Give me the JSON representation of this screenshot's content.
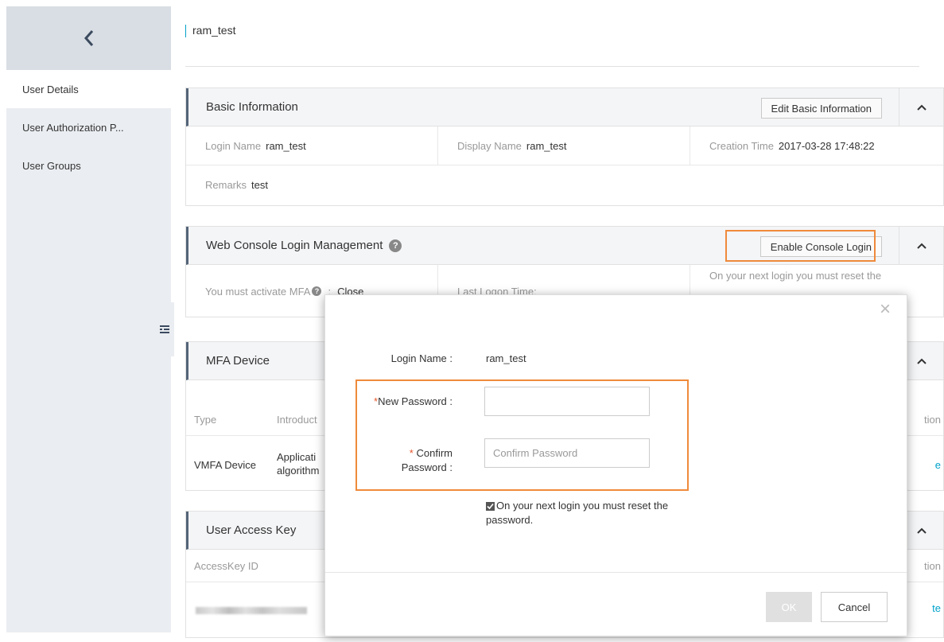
{
  "sidebar": {
    "items": [
      {
        "label": "User Details"
      },
      {
        "label": "User Authorization P..."
      },
      {
        "label": "User Groups"
      }
    ]
  },
  "page": {
    "title": "ram_test"
  },
  "basic_info": {
    "title": "Basic Information",
    "edit_button": "Edit Basic Information",
    "login_name_label": "Login Name",
    "login_name": "ram_test",
    "display_name_label": "Display Name",
    "display_name": "ram_test",
    "creation_time_label": "Creation Time",
    "creation_time": "2017-03-28 17:48:22",
    "remarks_label": "Remarks",
    "remarks": "test"
  },
  "console_login": {
    "title": "Web Console Login Management",
    "enable_button": "Enable Console Login",
    "mfa_label": "You must activate MFA",
    "mfa_value": "Close",
    "last_logon_label": "Last Logon Time:",
    "reset_text": "On your next login you must reset the"
  },
  "mfa": {
    "title": "MFA Device",
    "col_type": "Type",
    "col_intro": "Introduct",
    "col_action": "tion",
    "row_type": "VMFA Device",
    "row_intro_1": "Applicati",
    "row_intro_2": "algorithm",
    "row_action": "e"
  },
  "access_key": {
    "title": "User Access Key",
    "col_id": "AccessKey ID",
    "col_action": "tion",
    "row_action": "te"
  },
  "modal": {
    "login_name_label": "Login Name :",
    "login_name": "ram_test",
    "new_password_req": "*",
    "new_password_label": "New Password :",
    "new_password_value": "",
    "confirm_req": "*",
    "confirm_label_1": "Confirm",
    "confirm_label_2": "Password :",
    "confirm_placeholder": "Confirm Password",
    "reset_checkbox_line1": "On your next login you must reset the",
    "reset_checkbox_line2": "password.",
    "reset_checked": true,
    "ok": "OK",
    "cancel": "Cancel",
    "close_symbol": "×"
  },
  "colors": {
    "accent": "#00a2ca",
    "highlight": "#ef8a3b",
    "required": "#e8572b"
  }
}
